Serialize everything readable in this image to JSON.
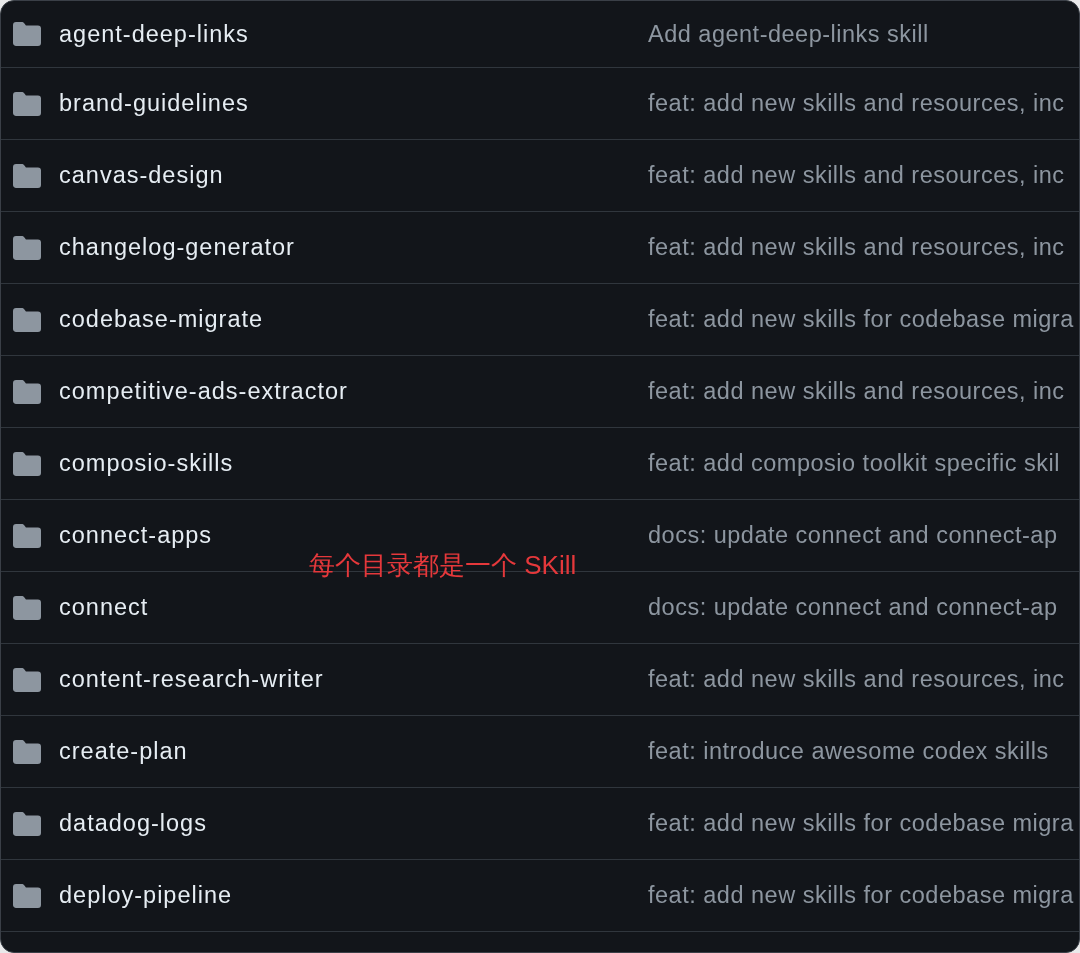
{
  "rows": [
    {
      "name": "agent-deep-links",
      "message": "Add agent-deep-links skill"
    },
    {
      "name": "brand-guidelines",
      "message": "feat: add new skills and resources, inc"
    },
    {
      "name": "canvas-design",
      "message": "feat: add new skills and resources, inc"
    },
    {
      "name": "changelog-generator",
      "message": "feat: add new skills and resources, inc"
    },
    {
      "name": "codebase-migrate",
      "message": "feat: add new skills for codebase migra"
    },
    {
      "name": "competitive-ads-extractor",
      "message": "feat: add new skills and resources, inc"
    },
    {
      "name": "composio-skills",
      "message": "feat: add composio toolkit specific skil"
    },
    {
      "name": "connect-apps",
      "message": "docs: update connect and connect-ap"
    },
    {
      "name": "connect",
      "message": "docs: update connect and connect-ap"
    },
    {
      "name": "content-research-writer",
      "message": "feat: add new skills and resources, inc"
    },
    {
      "name": "create-plan",
      "message": "feat: introduce awesome codex skills"
    },
    {
      "name": "datadog-logs",
      "message": "feat: add new skills for codebase migra"
    },
    {
      "name": "deploy-pipeline",
      "message": "feat: add new skills for codebase migra"
    }
  ],
  "annotation": {
    "text": "每个目录都是一个 SKill"
  }
}
